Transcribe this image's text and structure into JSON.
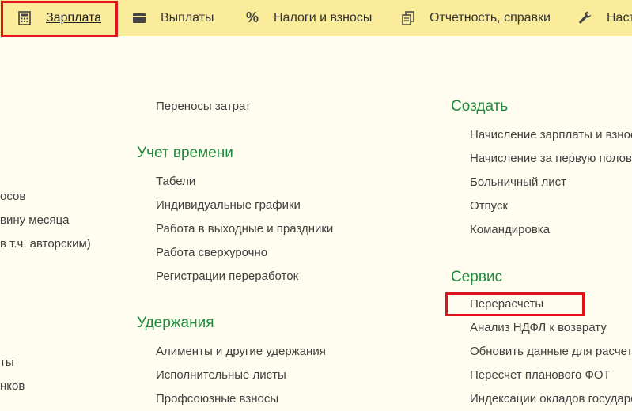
{
  "tabs": [
    {
      "label": "Зарплата",
      "icon": "calculator-icon"
    },
    {
      "label": "Выплаты",
      "icon": "wallet-icon"
    },
    {
      "label": "Налоги и взносы",
      "icon": "percent-icon"
    },
    {
      "label": "Отчетность, справки",
      "icon": "reports-icon"
    },
    {
      "label": "Настройка",
      "icon": "wrench-icon"
    }
  ],
  "left_column": {
    "items": [
      "осов",
      "вину месяца",
      "в т.ч. авторским)",
      "ты",
      "нков"
    ]
  },
  "middle_column": {
    "top_item": "Переносы затрат",
    "time_group": {
      "title": "Учет времени",
      "items": [
        "Табели",
        "Индивидуальные графики",
        "Работа в выходные и праздники",
        "Работа сверхурочно",
        "Регистрации переработок"
      ]
    },
    "deductions_group": {
      "title": "Удержания",
      "items": [
        "Алименты и другие удержания",
        "Исполнительные листы",
        "Профсоюзные взносы"
      ]
    }
  },
  "right_column": {
    "create_group": {
      "title": "Создать",
      "items": [
        "Начисление зарплаты и взносов",
        "Начисление за первую половину месяца",
        "Больничный лист",
        "Отпуск",
        "Командировка"
      ]
    },
    "service_group": {
      "title": "Сервис",
      "items": [
        "Перерасчеты",
        "Анализ НДФЛ к возврату",
        "Обновить данные для расчета",
        "Пересчет планового ФОТ",
        "Индексации окладов государственных"
      ]
    }
  },
  "colors": {
    "highlight": "#e0141c",
    "group_title": "#1f8a3c",
    "topbar": "#fbec9c",
    "background": "#fffdf0"
  }
}
